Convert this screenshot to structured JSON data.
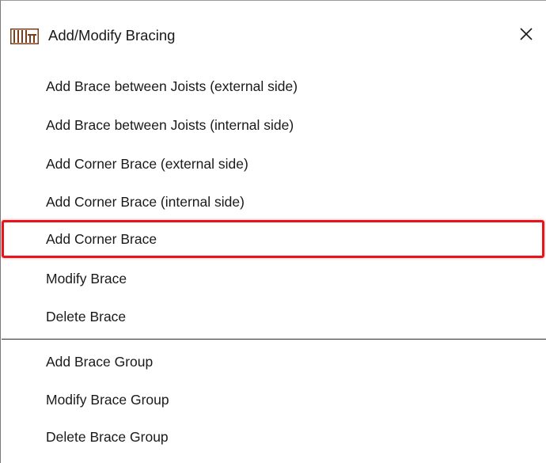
{
  "dialog": {
    "title": "Add/Modify Bracing",
    "title_icon": "bracing-icon",
    "close_icon": "close-icon"
  },
  "menu": {
    "group1": [
      {
        "label": "Add Brace between Joists (external side)"
      },
      {
        "label": "Add Brace between Joists (internal side)"
      },
      {
        "label": "Add Corner Brace (external side)"
      },
      {
        "label": "Add Corner Brace (internal side)"
      },
      {
        "label": "Add Corner Brace",
        "highlighted": true
      },
      {
        "label": "Modify Brace"
      },
      {
        "label": "Delete Brace"
      }
    ],
    "group2": [
      {
        "label": "Add Brace Group"
      },
      {
        "label": "Modify Brace Group"
      },
      {
        "label": "Delete Brace Group"
      }
    ]
  },
  "colors": {
    "highlight_border": "#e8141c",
    "icon_color": "#7a3e1a",
    "separator": "#2a2a2a"
  }
}
